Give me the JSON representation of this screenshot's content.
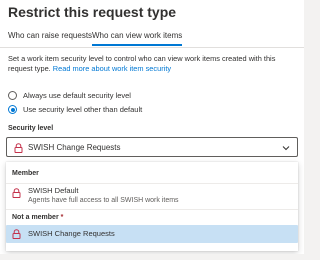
{
  "panel": {
    "title": "Restrict this request type"
  },
  "tabs": [
    {
      "label": "Who can raise requests",
      "active": false
    },
    {
      "label": "Who can view work items",
      "active": true
    }
  ],
  "description": {
    "text": "Set a work item security level to control who can view work items created with this request type. ",
    "link": "Read more about work item security"
  },
  "radios": [
    {
      "label": "Always use default security level",
      "checked": false
    },
    {
      "label": "Use security level other than default",
      "checked": true
    }
  ],
  "security_level": {
    "label": "Security level",
    "required_marker": "*",
    "selected": "SWISH Change Requests"
  },
  "dropdown": {
    "groups": [
      {
        "header": "Member",
        "options": [
          {
            "name": "SWISH Default",
            "description": "Agents have full access to all SWISH work items"
          }
        ]
      },
      {
        "header": "Not a member",
        "options": [
          {
            "name": "SWISH Change Requests",
            "description": ""
          }
        ]
      }
    ]
  },
  "colors": {
    "accent": "#0078d4",
    "lock": "#c4314b",
    "selected_bg": "#c7e0f4",
    "required": "#a4262c"
  },
  "icons": {
    "lock": "lock-icon",
    "chevron": "chevron-down-icon"
  }
}
